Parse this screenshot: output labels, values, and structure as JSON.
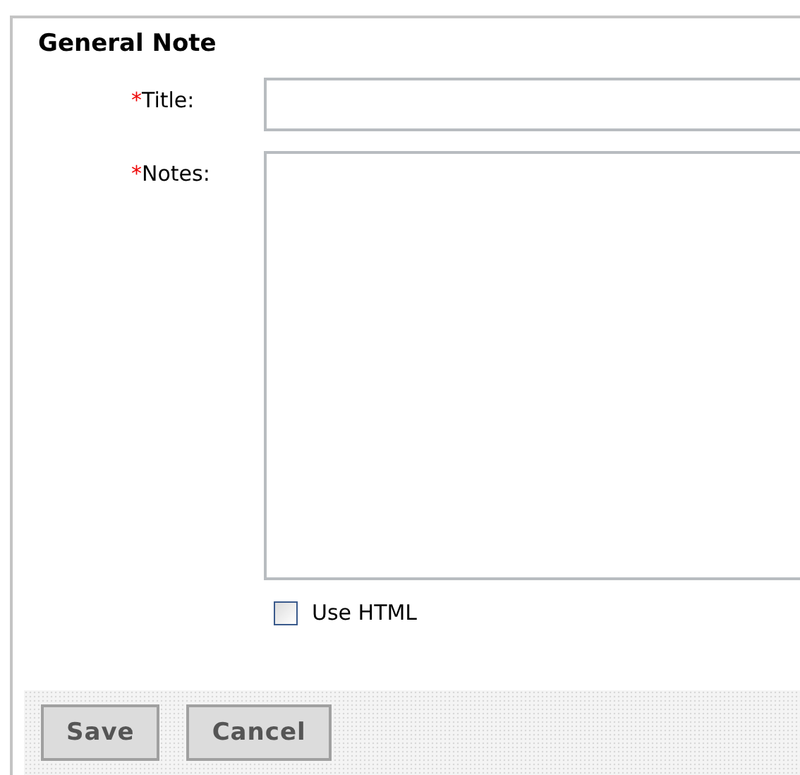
{
  "panel": {
    "title": "General Note"
  },
  "fields": [
    {
      "kind": "text",
      "label": "Title:",
      "required_mark": "*"
    },
    {
      "kind": "textarea",
      "label": "Notes:",
      "required_mark": "*"
    }
  ],
  "option": {
    "label": "Use HTML",
    "checked": false
  },
  "buttons": [
    "Save",
    "Cancel"
  ]
}
